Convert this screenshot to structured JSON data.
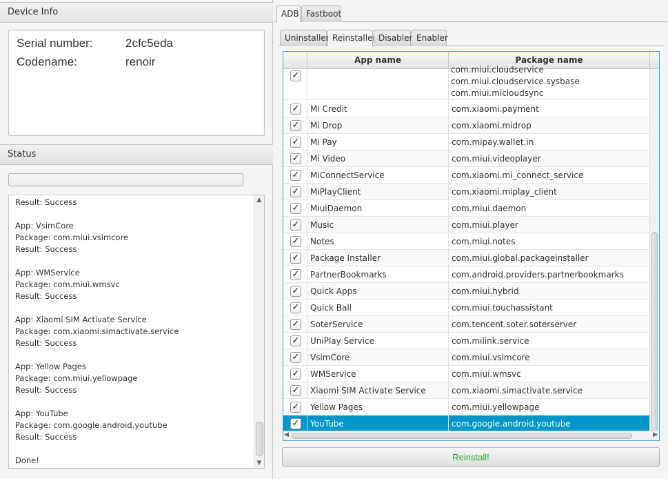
{
  "device_info": {
    "header": "Device Info",
    "serial_label": "Serial number:",
    "serial_value": "2cfc5eda",
    "codename_label": "Codename:",
    "codename_value": "renoir"
  },
  "status": {
    "header": "Status",
    "progress": 0.0,
    "log": "Result: Success\n\nApp: VsimCore\nPackage: com.miui.vsimcore\nResult: Success\n\nApp: WMService\nPackage: com.miui.wmsvc\nResult: Success\n\nApp: Xiaomi SIM Activate Service\nPackage: com.xiaomi.simactivate.service\nResult: Success\n\nApp: Yellow Pages\nPackage: com.miui.yellowpage\nResult: Success\n\nApp: YouTube\nPackage: com.google.android.youtube\nResult: Success\n\nDone!"
  },
  "main_tabs": [
    "ADB",
    "Fastboot"
  ],
  "sub_tabs": [
    "Uninstaller",
    "Reinstaller",
    "Disabler",
    "Enabler"
  ],
  "table": {
    "columns": [
      "App name",
      "Package name"
    ],
    "first_row_packages": "com.miui.cloudservice\ncom.miui.cloudservice.sysbase\ncom.miui.micloudsync",
    "rows": [
      {
        "app": "Mi Credit",
        "pkg": "com.xiaomi.payment"
      },
      {
        "app": "Mi Drop",
        "pkg": "com.xiaomi.midrop"
      },
      {
        "app": "Mi Pay",
        "pkg": "com.mipay.wallet.in"
      },
      {
        "app": "Mi Video",
        "pkg": "com.miui.videoplayer"
      },
      {
        "app": "MiConnectService",
        "pkg": "com.xiaomi.mi_connect_service"
      },
      {
        "app": "MiPlayClient",
        "pkg": "com.xiaomi.miplay_client"
      },
      {
        "app": "MiuiDaemon",
        "pkg": "com.miui.daemon"
      },
      {
        "app": "Music",
        "pkg": "com.miui.player"
      },
      {
        "app": "Notes",
        "pkg": "com.miui.notes"
      },
      {
        "app": "Package Installer",
        "pkg": "com.miui.global.packageinstaller"
      },
      {
        "app": "PartnerBookmarks",
        "pkg": "com.android.providers.partnerbookmarks"
      },
      {
        "app": "Quick Apps",
        "pkg": "com.miui.hybrid"
      },
      {
        "app": "Quick Ball",
        "pkg": "com.miui.touchassistant"
      },
      {
        "app": "SoterService",
        "pkg": "com.tencent.soter.soterserver"
      },
      {
        "app": "UniPlay Service",
        "pkg": "com.milink.service"
      },
      {
        "app": "VsimCore",
        "pkg": "com.miui.vsimcore"
      },
      {
        "app": "WMService",
        "pkg": "com.miui.wmsvc"
      },
      {
        "app": "Xiaomi SIM Activate Service",
        "pkg": "com.xiaomi.simactivate.service"
      },
      {
        "app": "Yellow Pages",
        "pkg": "com.miui.yellowpage"
      },
      {
        "app": "YouTube",
        "pkg": "com.google.android.youtube"
      }
    ]
  },
  "reinstall_label": "Reinstall!",
  "colors": {
    "accent": "#0096c9",
    "button_text": "#2cab2c"
  }
}
